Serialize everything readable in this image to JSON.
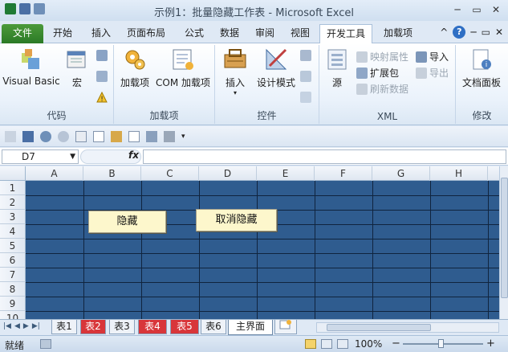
{
  "window": {
    "title": "示例1：批量隐藏工作表 - Microsoft Excel",
    "minimize_label": "─",
    "restore_label": "▭",
    "close_label": "✕"
  },
  "ribbon_tabs": [
    "文件",
    "开始",
    "插入",
    "页面布局",
    "公式",
    "数据",
    "审阅",
    "视图",
    "开发工具",
    "加载项"
  ],
  "active_tab": "开发工具",
  "ribbon_right": {
    "caret": "^",
    "help": "?",
    "min": "─",
    "restore": "▭",
    "close": "✕"
  },
  "groups": {
    "code": {
      "label": "代码",
      "visual_basic": "Visual Basic",
      "macro": "宏"
    },
    "addins": {
      "label": "加载项",
      "addin": "加载项",
      "com_addin": "COM 加载项"
    },
    "controls": {
      "label": "控件",
      "insert": "插入",
      "design_mode": "设计模式"
    },
    "xml": {
      "label": "XML",
      "source": "源",
      "map_properties": "映射属性",
      "expansion_pack": "扩展包",
      "refresh_data": "刷新数据",
      "import": "导入",
      "export": "导出"
    },
    "modify": {
      "label": "修改",
      "doc_panel": "文档面板"
    }
  },
  "formula_bar": {
    "name_box": "D7",
    "fx": "fx",
    "formula": ""
  },
  "columns": [
    "A",
    "B",
    "C",
    "D",
    "E",
    "F",
    "G",
    "H"
  ],
  "rows": [
    "1",
    "2",
    "3",
    "4",
    "5",
    "6",
    "7",
    "8",
    "9",
    "10"
  ],
  "sheet_buttons": {
    "hide": "隐藏",
    "unhide": "取消隐藏"
  },
  "colors": {
    "sheet_bg": "#2f5c8f",
    "button_bg": "#fdf7cc",
    "tab_red": "#d8363a",
    "file_tab": "#2b7a26"
  },
  "sheet_tabs": [
    {
      "name": "表1",
      "style": "normal"
    },
    {
      "name": "表2",
      "style": "red"
    },
    {
      "name": "表3",
      "style": "normal"
    },
    {
      "name": "表4",
      "style": "red"
    },
    {
      "name": "表5",
      "style": "red"
    },
    {
      "name": "表6",
      "style": "normal"
    },
    {
      "name": "主界面",
      "style": "active"
    }
  ],
  "status": {
    "ready": "就绪",
    "zoom": "100%",
    "zoom_minus": "−",
    "zoom_plus": "+"
  }
}
